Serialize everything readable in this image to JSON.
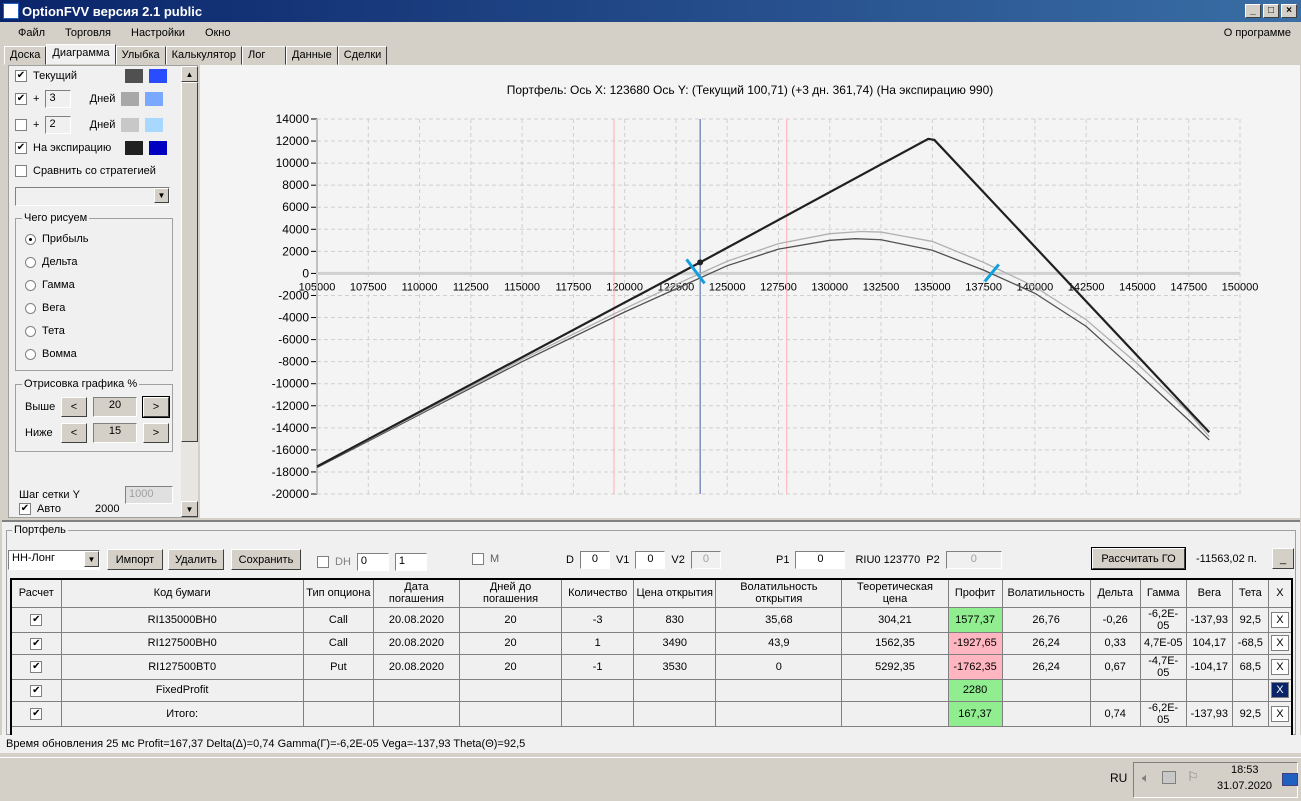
{
  "window": {
    "title": "OptionFVV версия 2.1 public"
  },
  "menu": [
    "Файл",
    "Торговля",
    "Настройки",
    "Окно"
  ],
  "about": "О программе",
  "tabs": [
    "Доска",
    "Диаграмма",
    "Улыбка",
    "Калькулятор",
    "Лог",
    "Данные",
    "Сделки"
  ],
  "left": {
    "current_label": "Текущий",
    "plus": "+",
    "days_label": "Дней",
    "days1": "3",
    "days2": "2",
    "expiry_label": "На экспирацию",
    "compare_label": "Сравнить со стратегией",
    "draw_group": "Чего рисуем",
    "radios": [
      "Прибыль",
      "Дельта",
      "Гамма",
      "Вега",
      "Тета",
      "Вомма"
    ],
    "range_group": "Отрисовка графика %",
    "above_label": "Выше",
    "above_value": "20",
    "below_label": "Ниже",
    "below_value": "15",
    "prev": "<",
    "next": ">",
    "grid_step_label": "Шаг сетки Y",
    "grid_step_value": "1000",
    "auto_label": "Авто",
    "auto_value": "2000",
    "colors": {
      "current": [
        "#505050",
        "#2a4cff"
      ],
      "days1": [
        "#a8a8a8",
        "#7aa8ff"
      ],
      "days2": [
        "#c8c8c8",
        "#a8d8ff"
      ],
      "expiry": [
        "#202020",
        "#0000c0"
      ]
    }
  },
  "chart_title": "Портфель: Ось X: 123680 Ось Y:  (Текущий 100,71)  (+3 дн. 361,74)  (На экспирацию 990)",
  "chart_data": {
    "type": "line",
    "title": "Портфель: Ось X: 123680 Ось Y:  (Текущий 100,71)  (+3 дн. 361,74)  (На экспирацию 990)",
    "xlim": [
      105000,
      150000
    ],
    "ylim": [
      -20000,
      14000
    ],
    "xticks": [
      "105000",
      "107500",
      "110000",
      "112500",
      "115000",
      "117500",
      "120000",
      "122500",
      "125000",
      "127500",
      "130000",
      "132500",
      "135000",
      "137500",
      "140000",
      "142500",
      "145000",
      "147500",
      "150000"
    ],
    "yticks": [
      "14000",
      "12000",
      "10000",
      "8000",
      "6000",
      "4000",
      "2000",
      "0",
      "-2000",
      "-4000",
      "-6000",
      "-8000",
      "-10000",
      "-12000",
      "-14000",
      "-16000",
      "-18000",
      "-20000"
    ],
    "grid": true,
    "cursor_x": 123680,
    "range_lines": [
      119480,
      127900
    ],
    "series": [
      {
        "name": "На экспирацию",
        "color": "#202020",
        "points": [
          [
            105000,
            -17500
          ],
          [
            123680,
            1000
          ],
          [
            134800,
            12200
          ],
          [
            135100,
            12100
          ],
          [
            148500,
            -14400
          ]
        ]
      },
      {
        "name": "+3 дн.",
        "color": "#b0b0b0",
        "points": [
          [
            105000,
            -17500
          ],
          [
            110000,
            -12700
          ],
          [
            115000,
            -7800
          ],
          [
            120000,
            -3200
          ],
          [
            122500,
            -1000
          ],
          [
            125000,
            1100
          ],
          [
            127500,
            2700
          ],
          [
            130000,
            3600
          ],
          [
            131500,
            3800
          ],
          [
            132500,
            3750
          ],
          [
            135000,
            2900
          ],
          [
            137500,
            1000
          ],
          [
            140000,
            -1200
          ],
          [
            142500,
            -4200
          ],
          [
            145000,
            -8200
          ],
          [
            147500,
            -12600
          ],
          [
            148500,
            -14800
          ]
        ]
      },
      {
        "name": "Текущий",
        "color": "#505050",
        "points": [
          [
            105000,
            -17600
          ],
          [
            110000,
            -12800
          ],
          [
            115000,
            -8000
          ],
          [
            120000,
            -3500
          ],
          [
            122500,
            -1400
          ],
          [
            125000,
            700
          ],
          [
            127500,
            2200
          ],
          [
            130000,
            3000
          ],
          [
            131250,
            3150
          ],
          [
            132500,
            3050
          ],
          [
            135000,
            2100
          ],
          [
            137500,
            300
          ],
          [
            140000,
            -1800
          ],
          [
            142500,
            -4800
          ],
          [
            145000,
            -9000
          ],
          [
            147500,
            -13300
          ],
          [
            148500,
            -15100
          ]
        ]
      }
    ],
    "breakeven_markers": [
      123700,
      137900
    ]
  },
  "portfolio": {
    "group": "Портфель",
    "name": "НН-Лонг",
    "import": "Импорт",
    "delete": "Удалить",
    "save": "Сохранить",
    "dh": "DH",
    "spin1": "0",
    "spin2": "1",
    "m": "M",
    "d_label": "D",
    "d": "0",
    "v1_label": "V1",
    "v1": "0",
    "v2_label": "V2",
    "v2": "0",
    "p1_label": "P1",
    "p1": "0",
    "instrument": "RIU0 123770",
    "p2_label": "P2",
    "p2": "0",
    "calc": "Рассчитать ГО",
    "go_value": "-11563,02 п.",
    "min": "_",
    "headers": [
      "Расчет",
      "Код бумаги",
      "Тип опциона",
      "Дата погашения",
      "Дней до погашения",
      "Количество",
      "Цена открытия",
      "Волатильность открытия",
      "Теоретическая цена",
      "Профит",
      "Волатильность",
      "Дельта",
      "Гамма",
      "Вега",
      "Тета",
      "X"
    ],
    "rows": [
      [
        "RI135000BH0",
        "Call",
        "20.08.2020",
        "20",
        "-3",
        "830",
        "35,68",
        "304,21",
        "1577,37",
        "26,76",
        "-0,26",
        "-6,2E-05",
        "-137,93",
        "92,5",
        "X"
      ],
      [
        "RI127500BH0",
        "Call",
        "20.08.2020",
        "20",
        "1",
        "3490",
        "43,9",
        "1562,35",
        "-1927,65",
        "26,24",
        "0,33",
        "4,7E-05",
        "104,17",
        "-68,5",
        "X"
      ],
      [
        "RI127500BT0",
        "Put",
        "20.08.2020",
        "20",
        "-1",
        "3530",
        "0",
        "5292,35",
        "-1762,35",
        "26,24",
        "0,67",
        "-4,7E-05",
        "-104,17",
        "68,5",
        "X"
      ],
      [
        "FixedProfit",
        "",
        "",
        "",
        "",
        "",
        "",
        "",
        "2280",
        "",
        "",
        "",
        "",
        "",
        "X"
      ],
      [
        "Итого:",
        "",
        "",
        "",
        "",
        "",
        "",
        "",
        "167,37",
        "",
        "0,74",
        "-6,2E-05",
        "-137,93",
        "92,5",
        "X"
      ]
    ],
    "profit_colors": [
      "g",
      "r",
      "r",
      "g",
      "g"
    ]
  },
  "status": "Время обновления 25 мс  Profit=167,37 Delta(Δ)=0,74 Gamma(Γ)=-6,2E-05 Vega=-137,93 Theta(Θ)=92,5",
  "taskbar": {
    "lang": "RU",
    "time": "18:53",
    "date": "31.07.2020"
  }
}
